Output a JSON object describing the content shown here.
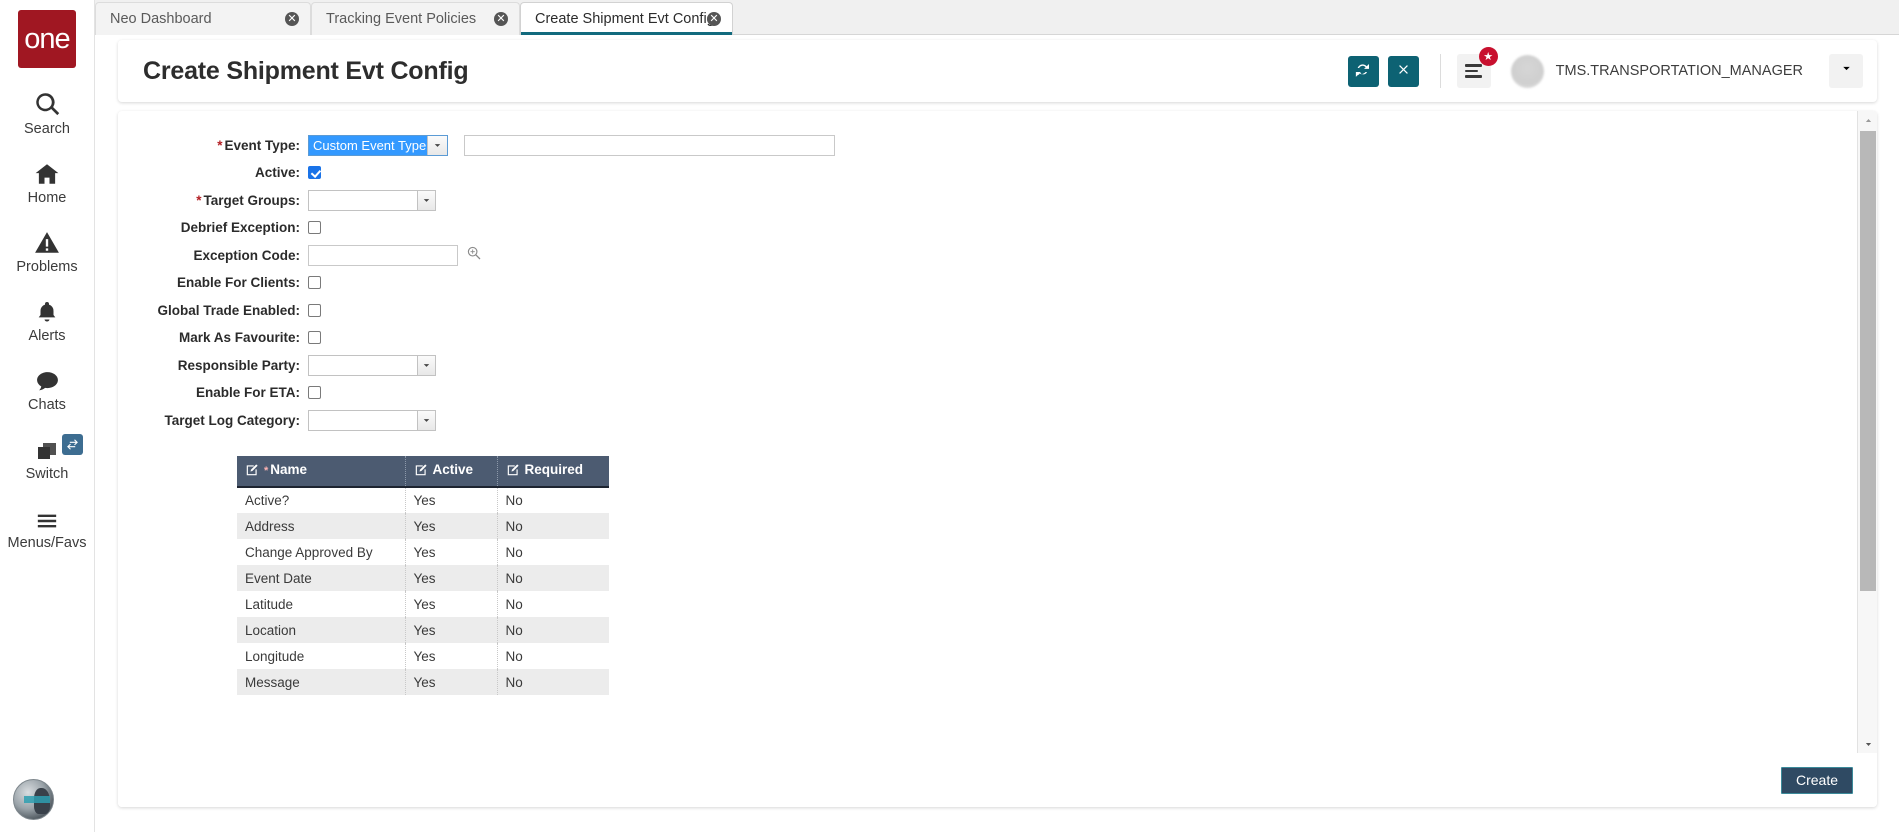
{
  "brand": {
    "logo_text": "one",
    "logo_color": "#a01722"
  },
  "sidebar": {
    "items": [
      {
        "label": "Search",
        "icon": "search-icon"
      },
      {
        "label": "Home",
        "icon": "home-icon"
      },
      {
        "label": "Problems",
        "icon": "warning-triangle-icon"
      },
      {
        "label": "Alerts",
        "icon": "bell-icon"
      },
      {
        "label": "Chats",
        "icon": "chat-bubble-icon"
      },
      {
        "label": "Switch",
        "icon": "windows-stack-icon",
        "badge_icon": "swap-arrows-icon"
      },
      {
        "label": "Menus/Favs",
        "icon": "hamburger-icon"
      }
    ]
  },
  "tabs": [
    {
      "label": "Neo Dashboard",
      "active": false,
      "close": "✕"
    },
    {
      "label": "Tracking Event Policies",
      "active": false,
      "close": "✕"
    },
    {
      "label": "Create Shipment Evt Config",
      "active": true,
      "close": "✕"
    }
  ],
  "header": {
    "title": "Create Shipment Evt Config",
    "refresh_icon": "refresh-icon",
    "close_icon": "close-x-icon",
    "menu_icon": "hamburger-menu-icon",
    "favorite_badge_icon": "star-badge-icon",
    "user_name": "TMS.TRANSPORTATION_MANAGER",
    "caret_icon": "chevron-down-icon",
    "accent_color": "#0d6273",
    "badge_color": "#c8102e"
  },
  "form": {
    "fields": [
      {
        "label": "Event Type",
        "required": true,
        "type": "combo-with-text",
        "value": "Custom Event Type",
        "focused": true,
        "text_value": ""
      },
      {
        "label": "Active",
        "required": false,
        "type": "checkbox",
        "checked": true
      },
      {
        "label": "Target Groups",
        "required": true,
        "type": "combo",
        "value": ""
      },
      {
        "label": "Debrief Exception",
        "required": false,
        "type": "checkbox",
        "checked": false
      },
      {
        "label": "Exception Code",
        "required": false,
        "type": "text-with-search",
        "value": "",
        "icon": "magnifier-icon"
      },
      {
        "label": "Enable For Clients",
        "required": false,
        "type": "checkbox",
        "checked": false
      },
      {
        "label": "Global Trade Enabled",
        "required": false,
        "type": "checkbox",
        "checked": false
      },
      {
        "label": "Mark As Favourite",
        "required": false,
        "type": "checkbox",
        "checked": false
      },
      {
        "label": "Responsible Party",
        "required": false,
        "type": "combo",
        "value": ""
      },
      {
        "label": "Enable For ETA",
        "required": false,
        "type": "checkbox",
        "checked": false
      },
      {
        "label": "Target Log Category",
        "required": false,
        "type": "combo",
        "value": ""
      }
    ]
  },
  "grid": {
    "columns": [
      {
        "label": "Name",
        "required": true,
        "edit_icon": "edit-pencil-icon"
      },
      {
        "label": "Active",
        "required": false,
        "edit_icon": "edit-pencil-icon"
      },
      {
        "label": "Required",
        "required": false,
        "edit_icon": "edit-pencil-icon"
      }
    ],
    "rows": [
      {
        "name": "Active?",
        "active": "Yes",
        "required": "No"
      },
      {
        "name": "Address",
        "active": "Yes",
        "required": "No"
      },
      {
        "name": "Change Approved By",
        "active": "Yes",
        "required": "No"
      },
      {
        "name": "Event Date",
        "active": "Yes",
        "required": "No"
      },
      {
        "name": "Latitude",
        "active": "Yes",
        "required": "No"
      },
      {
        "name": "Location",
        "active": "Yes",
        "required": "No"
      },
      {
        "name": "Longitude",
        "active": "Yes",
        "required": "No"
      },
      {
        "name": "Message",
        "active": "Yes",
        "required": "No"
      }
    ]
  },
  "footer": {
    "create_label": "Create"
  },
  "scrollbar": {
    "up_icon": "caret-up-icon",
    "down_icon": "caret-down-icon"
  }
}
